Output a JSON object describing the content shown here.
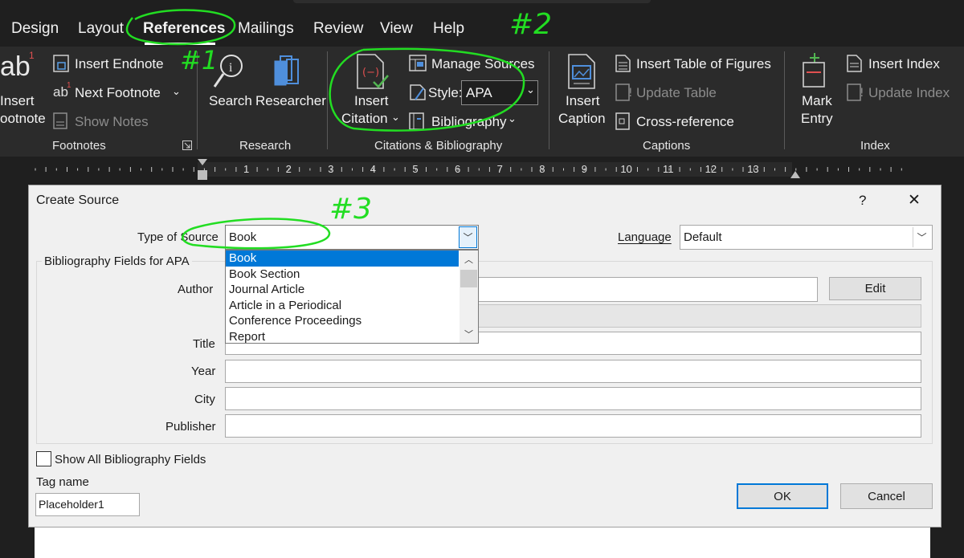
{
  "tabs": [
    "Design",
    "Layout",
    "References",
    "Mailings",
    "Review",
    "View",
    "Help"
  ],
  "ribbon": {
    "footnotes": {
      "insert_endnote": "Insert Endnote",
      "next_footnote": "Next Footnote",
      "show_notes": "Show Notes",
      "insert_label_1": "Insert",
      "insert_label_2": "ootnote",
      "ab_glyph": "ab",
      "group_label": "Footnotes"
    },
    "research": {
      "search": "Search",
      "researcher": "Researcher",
      "group_label": "Research"
    },
    "citations": {
      "insert_citation_1": "Insert",
      "insert_citation_2": "Citation",
      "manage_sources": "Manage Sources",
      "style_label": "Style:",
      "style_value": "APA",
      "bibliography": "Bibliography",
      "group_label": "Citations & Bibliography"
    },
    "captions": {
      "insert_caption_1": "Insert",
      "insert_caption_2": "Caption",
      "insert_table_of_figures": "Insert Table of Figures",
      "update_table": "Update Table",
      "cross_reference": "Cross-reference",
      "group_label": "Captions"
    },
    "index": {
      "mark_entry_1": "Mark",
      "mark_entry_2": "Entry",
      "insert_index": "Insert Index",
      "update_index": "Update Index",
      "group_label": "Index"
    }
  },
  "ruler": {
    "numbers": [
      "1",
      "2",
      "3",
      "4",
      "5",
      "6",
      "7",
      "8",
      "9",
      "10",
      "11",
      "12",
      "13"
    ]
  },
  "dialog": {
    "title": "Create Source",
    "help": "?",
    "close": "✕",
    "type_of_source_label": "Type of Source",
    "type_of_source_value": "Book",
    "language_label": "Language",
    "language_value": "Default",
    "fields_group_label": "Bibliography Fields for APA",
    "author_label": "Author",
    "title_label": "Title",
    "year_label": "Year",
    "city_label": "City",
    "publisher_label": "Publisher",
    "edit_button": "Edit",
    "show_all_label": "Show All Bibliography Fields",
    "tag_name_label": "Tag name",
    "tag_name_value": "Placeholder1",
    "ok_button": "OK",
    "cancel_button": "Cancel",
    "source_options": [
      "Book",
      "Book Section",
      "Journal Article",
      "Article in a Periodical",
      "Conference Proceedings",
      "Report"
    ],
    "selected_option": "Book"
  },
  "annotations": {
    "one": "#1",
    "two": "#2",
    "three": "#3"
  },
  "colors": {
    "ribbon_bg": "#2b2b2b",
    "tab_bg": "#1f1f1f",
    "accent": "#0078d7",
    "annotation": "#22dd22"
  }
}
